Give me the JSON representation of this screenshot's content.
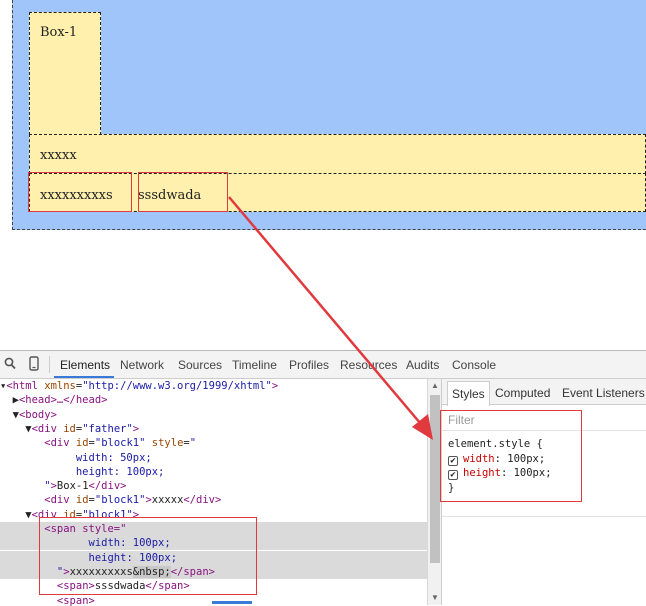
{
  "preview": {
    "box1_text": "Box-1",
    "line1_text": "xxxxx",
    "span1_text": "xxxxxxxxxs",
    "span2_text": "sssdwada"
  },
  "devtools": {
    "tabs": [
      "Elements",
      "Network",
      "Sources",
      "Timeline",
      "Profiles",
      "Resources",
      "Audits",
      "Console"
    ],
    "active_tab": "Elements",
    "dom": {
      "html_tag": "<html",
      "html_attr": "xmlns",
      "html_val": "\"http://www.w3.org/1999/xhtml\"",
      "head": "<head>…</head>",
      "body": "<body>",
      "father_attr": "id",
      "father_val": "\"father\"",
      "block1_id": "\"block1\"",
      "style_attr": "style",
      "style_open": "\"",
      "width50": "width: 50px;",
      "height100": "height: 100px;",
      "box1_close": "\">Box-1</div>",
      "line_xxxxx": "xxxxx",
      "span_style_open": "<span style=\"",
      "span_width": "width: 100px;",
      "span_height": "height: 100px;",
      "span_close_prefix": "\">xxxxxxxxxs",
      "nbsp": "&nbsp;",
      "span_close_suffix": "</span>",
      "span2": "<span>sssdwada</span>"
    },
    "sidebar": {
      "tabs": [
        "Styles",
        "Computed",
        "Event Listeners"
      ],
      "active_tab": "Styles",
      "filter_placeholder": "Filter",
      "selector": "element.style {",
      "rules": [
        {
          "prop": "width",
          "value": "100px;",
          "checked": true
        },
        {
          "prop": "height",
          "value": "100px;",
          "checked": true
        }
      ],
      "close_brace": "}"
    }
  },
  "colors": {
    "father_bg": "#9fc5fb",
    "block_bg": "#fff1ad",
    "annotation_red": "#e0393e",
    "accent_blue": "#3879d9"
  }
}
